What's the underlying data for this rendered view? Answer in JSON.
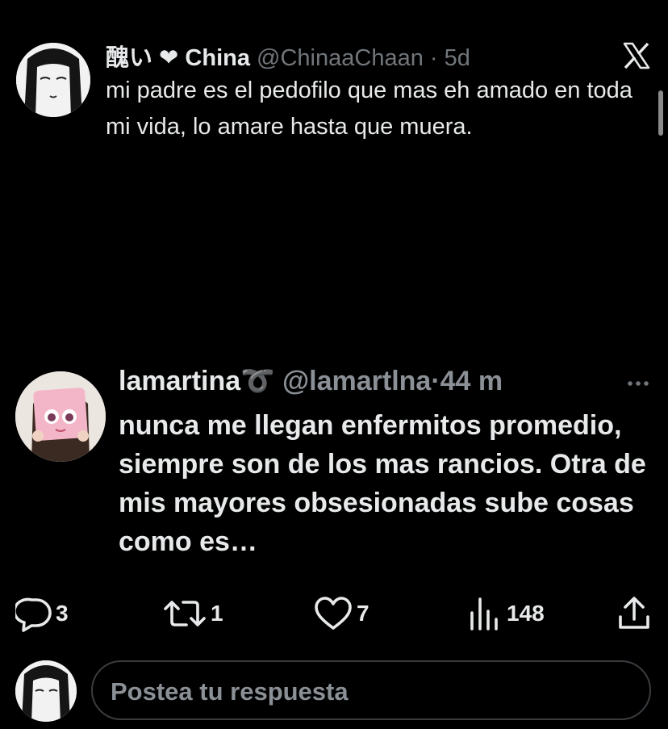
{
  "quoted_tweet": {
    "display_name": "醜い ❤ China",
    "handle": "@ChinaaChaan",
    "separator": "·",
    "time": "5d",
    "text": "mi padre es el pedofilo que mas eh amado en toda mi vida, lo amare hasta que muera."
  },
  "reply": {
    "display_name": "lamartina",
    "name_emoji": "➰",
    "handle": "@lamartlna",
    "separator": "·",
    "time": "44 m",
    "text": "nunca me llegan enfermitos promedio, siempre son de los mas rancios. Otra de mis mayores obsesionadas sube cosas como es…"
  },
  "actions": {
    "replies": "3",
    "reposts": "1",
    "likes": "7",
    "views": "148"
  },
  "compose": {
    "placeholder": "Postea tu respuesta"
  },
  "colors": {
    "background": "#000000",
    "text": "#e7e9ea",
    "muted": "#71767b",
    "emoji_red": "#d9433f"
  },
  "icons": [
    "x-logo-icon",
    "more-icon",
    "reply-icon",
    "repost-icon",
    "like-icon",
    "views-icon",
    "share-icon"
  ]
}
